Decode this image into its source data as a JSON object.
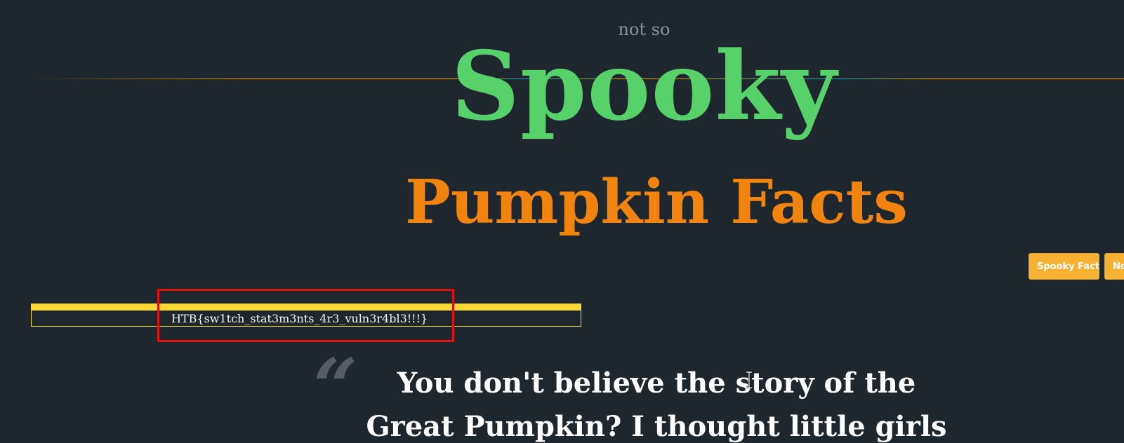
{
  "header": {
    "prefix": "not so",
    "title": "Spooky",
    "subtitle": "Pumpkin Facts"
  },
  "nav": {
    "items": [
      {
        "label": "Spooky Facts"
      },
      {
        "label": "Not so Spooky Facts"
      }
    ]
  },
  "alert": {
    "message": "HTB{sw1tch_stat3m3nts_4r3_vuln3r4bl3!!!}"
  },
  "quote": {
    "mark": "“",
    "lines": [
      "You don't believe the story of the",
      "Great Pumpkin? I thought little girls"
    ]
  },
  "colors": {
    "background": "#1f272e",
    "title_green": "#57d26a",
    "title_orange": "#f0840f",
    "button": "#f7b234",
    "alert_yellow": "#fdd835",
    "highlight_red": "#e01010"
  },
  "icons": {
    "cursor": "text-cursor-icon"
  }
}
